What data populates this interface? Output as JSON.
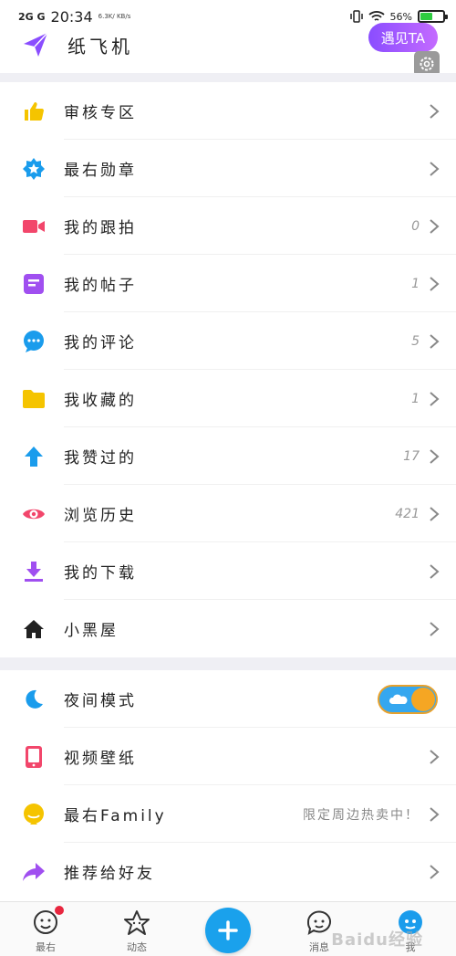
{
  "status_bar": {
    "network": "2G G",
    "time": "20:34",
    "speed": "6.3K/ KB/s",
    "battery_text": "56%"
  },
  "header": {
    "app_name": "纸飞机",
    "meet_button": "遇见TA"
  },
  "menu_group_1": [
    {
      "label": "审核专区",
      "icon": "thumbs-up-icon",
      "color": "#f5c400",
      "count": ""
    },
    {
      "label": "最右勋章",
      "icon": "star-badge-icon",
      "color": "#1a9cec",
      "count": ""
    },
    {
      "label": "我的跟拍",
      "icon": "video-camera-icon",
      "color": "#f2466b",
      "count": "0"
    },
    {
      "label": "我的帖子",
      "icon": "post-icon",
      "color": "#a04ff0",
      "count": "1"
    },
    {
      "label": "我的评论",
      "icon": "comment-icon",
      "color": "#1a9cec",
      "count": "5"
    },
    {
      "label": "我收藏的",
      "icon": "folder-icon",
      "color": "#f5c400",
      "count": "1"
    },
    {
      "label": "我赞过的",
      "icon": "arrow-up-icon",
      "color": "#1a9cec",
      "count": "17"
    },
    {
      "label": "浏览历史",
      "icon": "eye-icon",
      "color": "#f2466b",
      "count": "421"
    },
    {
      "label": "我的下载",
      "icon": "download-icon",
      "color": "#a04ff0",
      "count": ""
    },
    {
      "label": "小黑屋",
      "icon": "house-icon",
      "color": "#222222",
      "count": ""
    }
  ],
  "menu_group_2": [
    {
      "label": "夜间模式",
      "icon": "moon-icon",
      "color": "#1a9cec",
      "sub": "",
      "toggle": true
    },
    {
      "label": "视频壁纸",
      "icon": "phone-icon",
      "color": "#f2466b",
      "sub": "",
      "toggle": false
    },
    {
      "label": "最右Family",
      "icon": "family-mascot-icon",
      "color": "#f5c400",
      "sub": "限定周边热卖中！",
      "toggle": false
    },
    {
      "label": "推荐给好友",
      "icon": "share-icon",
      "color": "#a04ff0",
      "sub": "",
      "toggle": false
    }
  ],
  "bottom_nav": [
    {
      "label": "最右",
      "icon": "mascot-face-icon"
    },
    {
      "label": "动态",
      "icon": "star-face-icon"
    },
    {
      "label": "",
      "icon": "plus-icon"
    },
    {
      "label": "消息",
      "icon": "message-face-icon"
    },
    {
      "label": "我",
      "icon": "avatar-icon"
    }
  ],
  "watermark": "Baidu经验"
}
